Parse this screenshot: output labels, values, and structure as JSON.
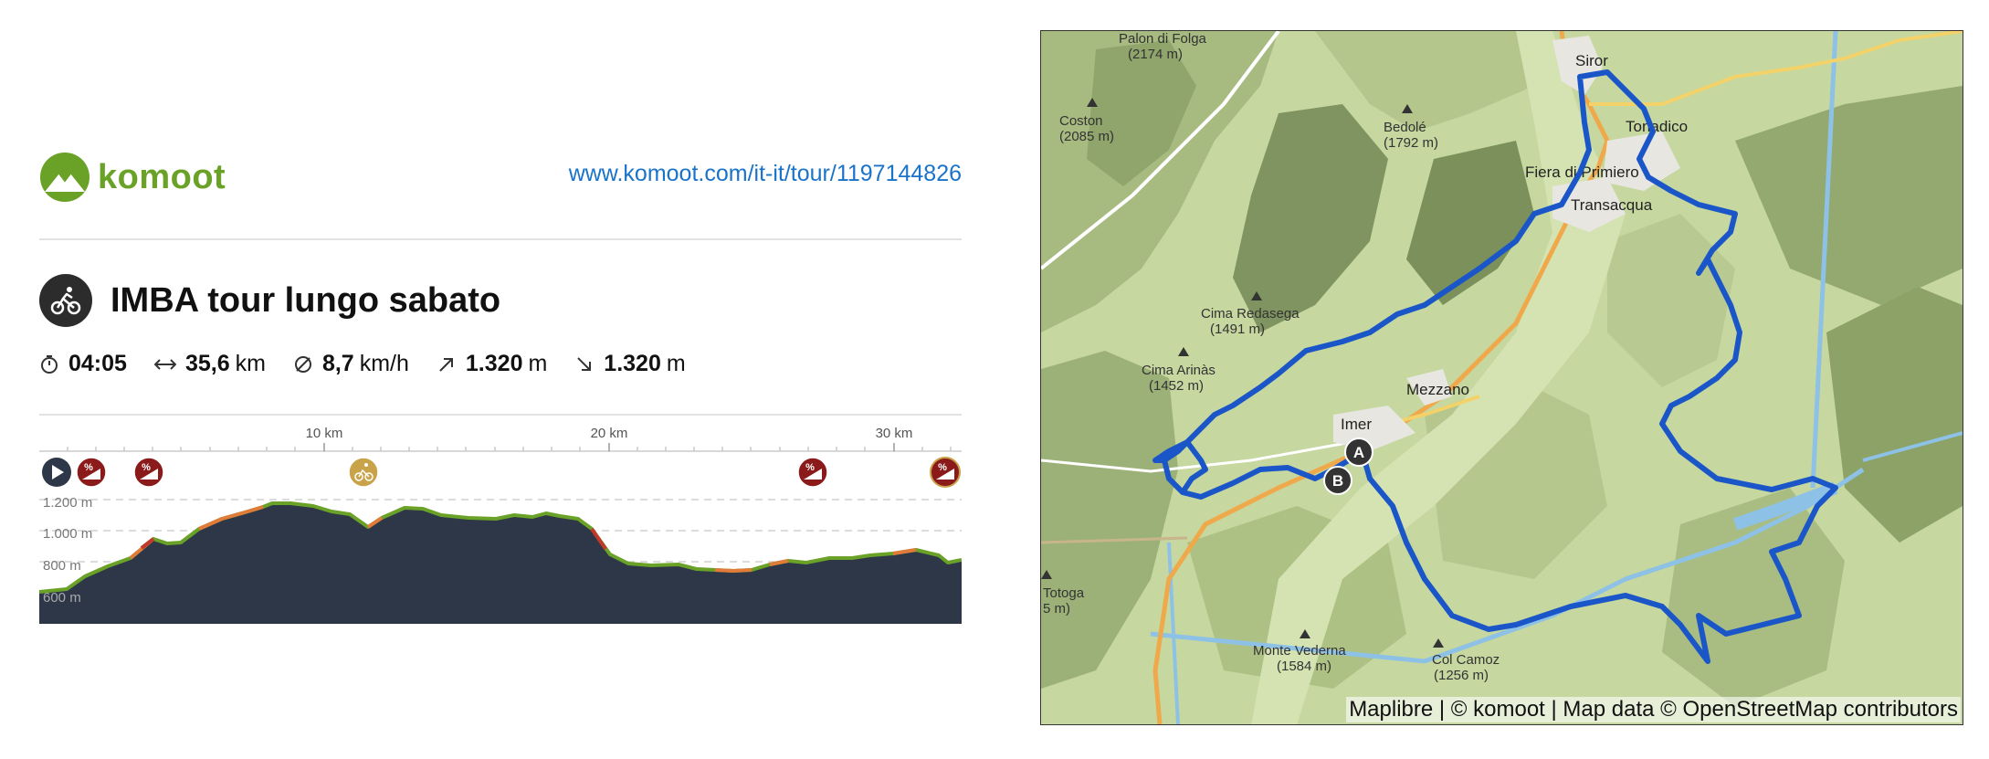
{
  "brand": {
    "name": "komoot",
    "color": "#6aa127"
  },
  "tour_url": "www.komoot.com/it-it/tour/1197144826",
  "tour": {
    "title": "IMBA tour lungo sabato",
    "sport_icon": "mountain-bike-icon"
  },
  "stats": {
    "duration": {
      "icon": "stopwatch-icon",
      "value": "04:05"
    },
    "distance": {
      "icon": "distance-arrows-icon",
      "value": "35,6",
      "unit": "km"
    },
    "speed": {
      "icon": "average-speed-icon",
      "value": "8,7",
      "unit": "km/h"
    },
    "uphill": {
      "icon": "arrow-up-right-icon",
      "value": "1.320",
      "unit": "m"
    },
    "downhill": {
      "icon": "arrow-down-right-icon",
      "value": "1.320",
      "unit": "m"
    }
  },
  "profile": {
    "x_ticks": [
      "10 km",
      "20 km",
      "30 km"
    ],
    "y_labels": [
      "1.200 m",
      "1.000 m",
      "800 m",
      "600 m"
    ],
    "markers": [
      {
        "type": "start-icon"
      },
      {
        "type": "steep-grade-icon"
      },
      {
        "type": "steep-grade-icon"
      },
      {
        "type": "cyclist-highlight-icon"
      },
      {
        "type": "steep-grade-icon"
      },
      {
        "type": "steep-grade-icon"
      }
    ],
    "fill_color": "#2d3748",
    "line_colors": [
      "#6aa127",
      "#e07b39",
      "#c0392b"
    ]
  },
  "map": {
    "places": [
      {
        "name": "Palon di Folga"
      },
      {
        "name": "(2174 m)"
      },
      {
        "name": "Coston"
      },
      {
        "name": "(2085 m)"
      },
      {
        "name": "Bedolé"
      },
      {
        "name": "(1792 m)"
      },
      {
        "name": "Siror"
      },
      {
        "name": "Tonadico"
      },
      {
        "name": "Fiera di Primiero"
      },
      {
        "name": "Transacqua"
      },
      {
        "name": "Cima Redasega"
      },
      {
        "name": "(1491 m)"
      },
      {
        "name": "Cima Arinàs"
      },
      {
        "name": "(1452 m)"
      },
      {
        "name": "Mezzano"
      },
      {
        "name": "Imer"
      },
      {
        "name": "Totoga"
      },
      {
        "name": "5 m)"
      },
      {
        "name": "Monte Vederna"
      },
      {
        "name": "(1584 m)"
      },
      {
        "name": "Col Camoz"
      },
      {
        "name": "(1256 m)"
      }
    ],
    "route_color": "#1a56c7",
    "start_label": "A",
    "end_label": "B",
    "attribution": "Maplibre | © komoot | Map data © OpenStreetMap contributors"
  }
}
